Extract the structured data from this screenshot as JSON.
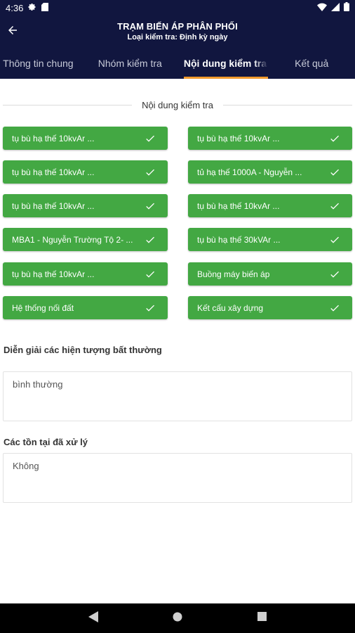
{
  "status_bar": {
    "time": "4:36",
    "icons": [
      "gear-icon",
      "sd-card-icon",
      "wifi-icon",
      "signal-icon",
      "battery-icon"
    ]
  },
  "app_bar": {
    "title": "TRẠM BIẾN ÁP PHÂN PHỐI",
    "subtitle": "Loại kiểm tra: Định kỳ ngày",
    "back_icon": "arrow-left-icon"
  },
  "tabs": [
    {
      "label": "Thông tin chung",
      "active": false
    },
    {
      "label": "Nhóm kiểm tra",
      "active": false
    },
    {
      "label": "Nội dung kiểm tra",
      "active": true
    },
    {
      "label": "Kết quả",
      "active": false
    }
  ],
  "section": {
    "title": "Nội dung kiểm tra"
  },
  "items": [
    {
      "label": "tụ bù hạ thế 10kvAr ...",
      "checked": true
    },
    {
      "label": "tụ bù hạ thế 10kvAr ...",
      "checked": true
    },
    {
      "label": "tụ bù hạ thế 10kvAr ...",
      "checked": true
    },
    {
      "label": "tủ hạ thế 1000A - Nguyễn ...",
      "checked": true
    },
    {
      "label": "tụ bù hạ thế 10kvAr ...",
      "checked": true
    },
    {
      "label": "tụ bù hạ thế 10kvAr ...",
      "checked": true
    },
    {
      "label": "MBA1 - Nguyễn Trường Tộ 2- ...",
      "checked": true
    },
    {
      "label": "tụ bù hạ thế 30kVAr ...",
      "checked": true
    },
    {
      "label": "tụ bù hạ thế 10kvAr ...",
      "checked": true
    },
    {
      "label": "Buồng máy biến áp",
      "checked": true
    },
    {
      "label": "Hệ thống nối đất",
      "checked": true
    },
    {
      "label": "Kết cấu xây dựng",
      "checked": true
    }
  ],
  "abnormal": {
    "label": "Diễn giải các hiện tượng bất thường",
    "value": "bình thường"
  },
  "handled": {
    "label": "Các tồn tại đã xử lý",
    "value": "Không"
  },
  "colors": {
    "primary": "#11163f",
    "accent": "#f19a2c",
    "item_green": "#43a843"
  }
}
